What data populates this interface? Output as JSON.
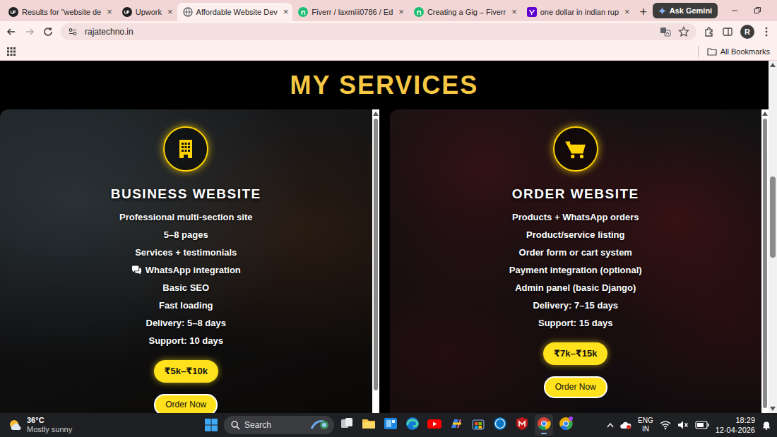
{
  "browser": {
    "tabs": [
      {
        "label": "Results for \"website de",
        "kind": "upwork",
        "selected": false
      },
      {
        "label": "Upwork",
        "kind": "upwork",
        "selected": false
      },
      {
        "label": "Affordable Website Dev",
        "kind": "site",
        "selected": true
      },
      {
        "label": "Fiverr / laxmiii0786 / Ed",
        "kind": "fiverr",
        "selected": false
      },
      {
        "label": "Creating a Gig – Fiverr",
        "kind": "fiverr",
        "selected": false
      },
      {
        "label": "one dollar in indian rup",
        "kind": "yahoo",
        "selected": false
      }
    ],
    "tab_close": "×",
    "new_tab": "+",
    "gemini_button": "Ask Gemini",
    "address": "rajatechno.in",
    "profile": "R",
    "bookmarks_folder": "All Bookmarks"
  },
  "page": {
    "heading": "MY SERVICES",
    "cards": [
      {
        "kind": "building",
        "title": "BUSINESS WEBSITE",
        "features": [
          {
            "text": "Professional multi-section site",
            "kind": "plain"
          },
          {
            "text": "5–8 pages",
            "kind": "plain"
          },
          {
            "text": "Services + testimonials",
            "kind": "plain"
          },
          {
            "text": "WhatsApp integration",
            "kind": "chat"
          },
          {
            "text": "Basic SEO",
            "kind": "plain"
          },
          {
            "text": "Fast loading",
            "kind": "plain"
          },
          {
            "text": "Delivery: 5–8 days",
            "kind": "plain"
          },
          {
            "text": "Support: 10 days",
            "kind": "plain"
          }
        ],
        "price": "₹5k–₹10k",
        "button": "Order Now"
      },
      {
        "kind": "cart",
        "title": "ORDER WEBSITE",
        "features": [
          {
            "text": "Products + WhatsApp orders",
            "kind": "plain"
          },
          {
            "text": "Product/service listing",
            "kind": "plain"
          },
          {
            "text": "Order form or cart system",
            "kind": "plain"
          },
          {
            "text": "Payment integration (optional)",
            "kind": "plain"
          },
          {
            "text": "Admin panel (basic Django)",
            "kind": "plain"
          },
          {
            "text": "Delivery: 7–15 days",
            "kind": "plain"
          },
          {
            "text": "Support: 15 days",
            "kind": "plain"
          }
        ],
        "price": "₹7k–₹15k",
        "button": "Order Now"
      }
    ]
  },
  "taskbar": {
    "weather": {
      "temp": "36°C",
      "desc": "Mostly sunny"
    },
    "search": "Search",
    "apps": [
      {
        "kind": "taskview",
        "active": false
      },
      {
        "kind": "explorer",
        "active": false
      },
      {
        "kind": "widgets",
        "active": false
      },
      {
        "kind": "edge",
        "active": false
      },
      {
        "kind": "youtube",
        "active": false
      },
      {
        "kind": "copilot",
        "active": false
      },
      {
        "kind": "store",
        "active": false
      },
      {
        "kind": "dell",
        "active": false
      },
      {
        "kind": "mcafee",
        "active": false
      },
      {
        "kind": "chrome",
        "active": true
      },
      {
        "kind": "chrome-alt",
        "active": false
      }
    ],
    "language": "ENG",
    "region": "IN",
    "time": "18:29",
    "date": "12-04-2026"
  }
}
